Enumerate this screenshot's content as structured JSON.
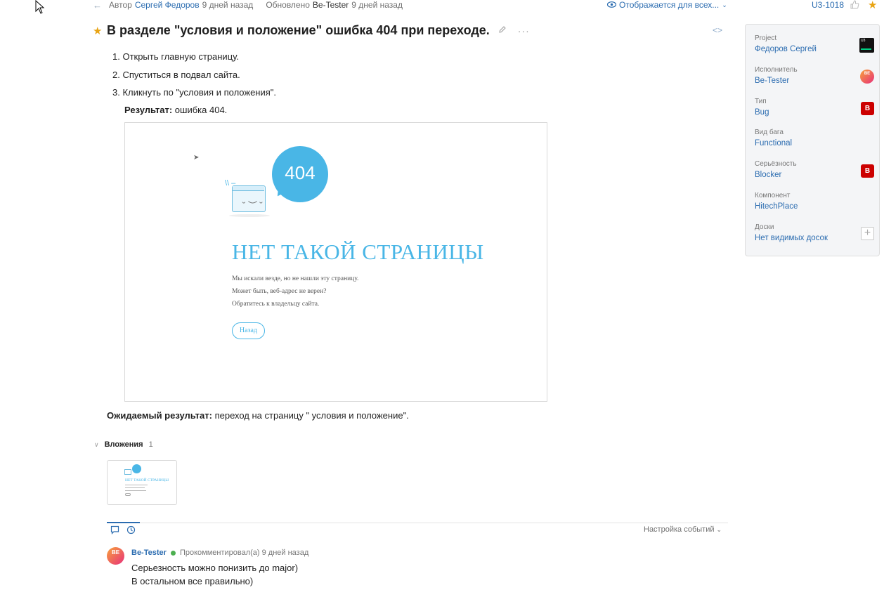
{
  "meta": {
    "author_prefix": "Автор",
    "author": "Сергей Федоров",
    "author_time": "9 дней назад",
    "updated_prefix": "Обновлено",
    "updater": "Be-Tester",
    "updated_time": "9 дней назад",
    "visibility": "Отображается для всех...",
    "issue_id": "U3-1018"
  },
  "issue": {
    "title": "В разделе \"условия и положение\" ошибка 404 при переходе.",
    "steps": [
      "1. Открыть главную страницу.",
      "2. Спуститься в подвал сайта.",
      "3. Кликнуть по \"условия и положения\"."
    ],
    "result_label": "Результат:",
    "result_text": " ошибка 404.",
    "expected_label": "Ожидаемый результат:",
    "expected_text": " переход на страницу \" условия и положение\"."
  },
  "screenshot": {
    "code": "404",
    "heading": "НЕТ ТАКОЙ СТРАНИЦЫ",
    "lines": [
      "Мы искали везде, но не нашли эту страницу.",
      "Может быть, веб-адрес не верен?",
      "Обратитесь к владельцу сайта."
    ],
    "back_button": "Назад"
  },
  "attachments": {
    "label": "Вложения",
    "count": "1"
  },
  "activity": {
    "events_settings": "Настройка событий"
  },
  "comment": {
    "avatar_initials": "BE",
    "author": "Be-Tester",
    "action": "Прокомментировал(а) 9 дней назад",
    "line1": "Серьезность можно понизить до major)",
    "line2": "В остальном все правильно)"
  },
  "fields": {
    "project_label": "Project",
    "project_value": "Федоров Сергей",
    "project_badge": "U3",
    "assignee_label": "Исполнитель",
    "assignee_value": "Be-Tester",
    "assignee_badge": "BE",
    "type_label": "Тип",
    "type_value": "Bug",
    "type_badge": "B",
    "bugkind_label": "Вид бага",
    "bugkind_value": "Functional",
    "severity_label": "Серьёзность",
    "severity_value": "Blocker",
    "severity_badge": "B",
    "component_label": "Компонент",
    "component_value": "HitechPlace",
    "boards_label": "Доски",
    "boards_value": "Нет видимых досок"
  },
  "colors": {
    "accent": "#2b6cb0",
    "star": "#e8a312",
    "badge_red": "#cc0000",
    "screenshot_blue": "#49b6e6"
  }
}
